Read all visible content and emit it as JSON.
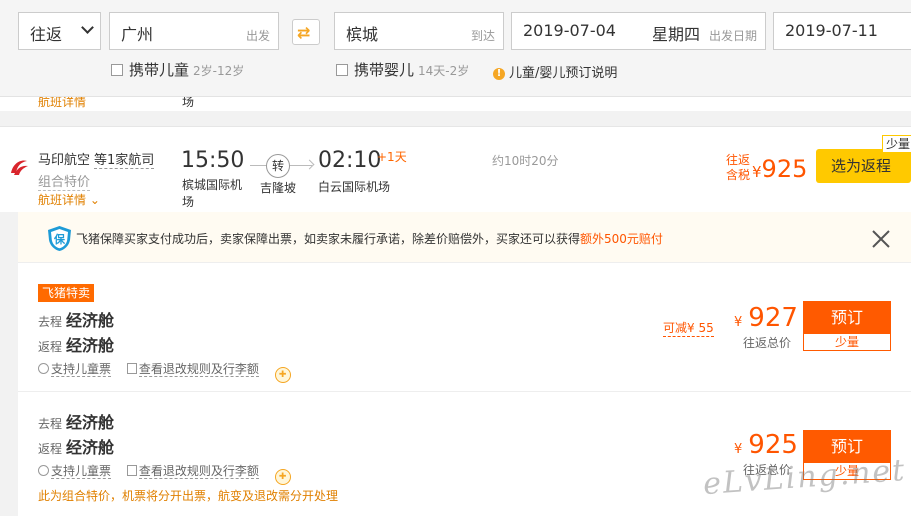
{
  "search": {
    "trip_type": "往返",
    "from_city": "广州",
    "from_hint": "出发",
    "to_city": "槟城",
    "to_hint": "到达",
    "depart_date": "2019-07-04",
    "depart_weekday": "星期四",
    "depart_hint": "出发日期",
    "return_date": "2019-07-11",
    "child_label": "携带儿童",
    "child_range": "2岁-12岁",
    "infant_label": "携带婴儿",
    "infant_range": "14天-2岁",
    "kid_note": "儿童/婴儿预订说明"
  },
  "prev_row": {
    "details": "航班详情",
    "airport_tail": "场"
  },
  "flight": {
    "airline": "马印航空",
    "more_airlines": "等1家航司",
    "combo": "组合特价",
    "details": "航班详情",
    "dep_time": "15:50",
    "dep_airport": "槟城国际机场",
    "transfer": "转",
    "stop": "吉隆坡",
    "arr_time": "02:10",
    "plus_day": "+1天",
    "arr_airport": "白云国际机场",
    "duration": "约10时20分",
    "price_label_1": "往返",
    "price_label_2": "含税",
    "currency": "¥",
    "price": "925",
    "button": "选为返程",
    "few_tag": "少量"
  },
  "guarantee": {
    "icon_char": "保",
    "text": "飞猪保障买家支付成功后，卖家保障出票，如卖家未履行承诺，除差价赔偿外，买家还可以获得",
    "highlight": "额外500元赔付"
  },
  "cabins": [
    {
      "tag": "飞猪特卖",
      "out_label": "去程",
      "out_class": "经济舱",
      "ret_label": "返程",
      "ret_class": "经济舱",
      "feat_child": "支持儿童票",
      "feat_rules": "查看退改规则及行李额",
      "discount": "可减¥ 55",
      "currency": "¥",
      "price": "927",
      "total_label": "往返总价",
      "book": "预订",
      "few": "少量"
    },
    {
      "out_label": "去程",
      "out_class": "经济舱",
      "ret_label": "返程",
      "ret_class": "经济舱",
      "feat_child": "支持儿童票",
      "feat_rules": "查看退改规则及行李额",
      "note": "此为组合特价，机票将分开出票，航变及退改需分开处理",
      "currency": "¥",
      "price": "925",
      "total_label": "往返总价",
      "book": "预订",
      "few": "少量"
    }
  ],
  "watermark": "eLvLing.net",
  "colors": {
    "accent": "#ff5a00",
    "yellow": "#ffc900",
    "orange_text": "#e08000"
  }
}
